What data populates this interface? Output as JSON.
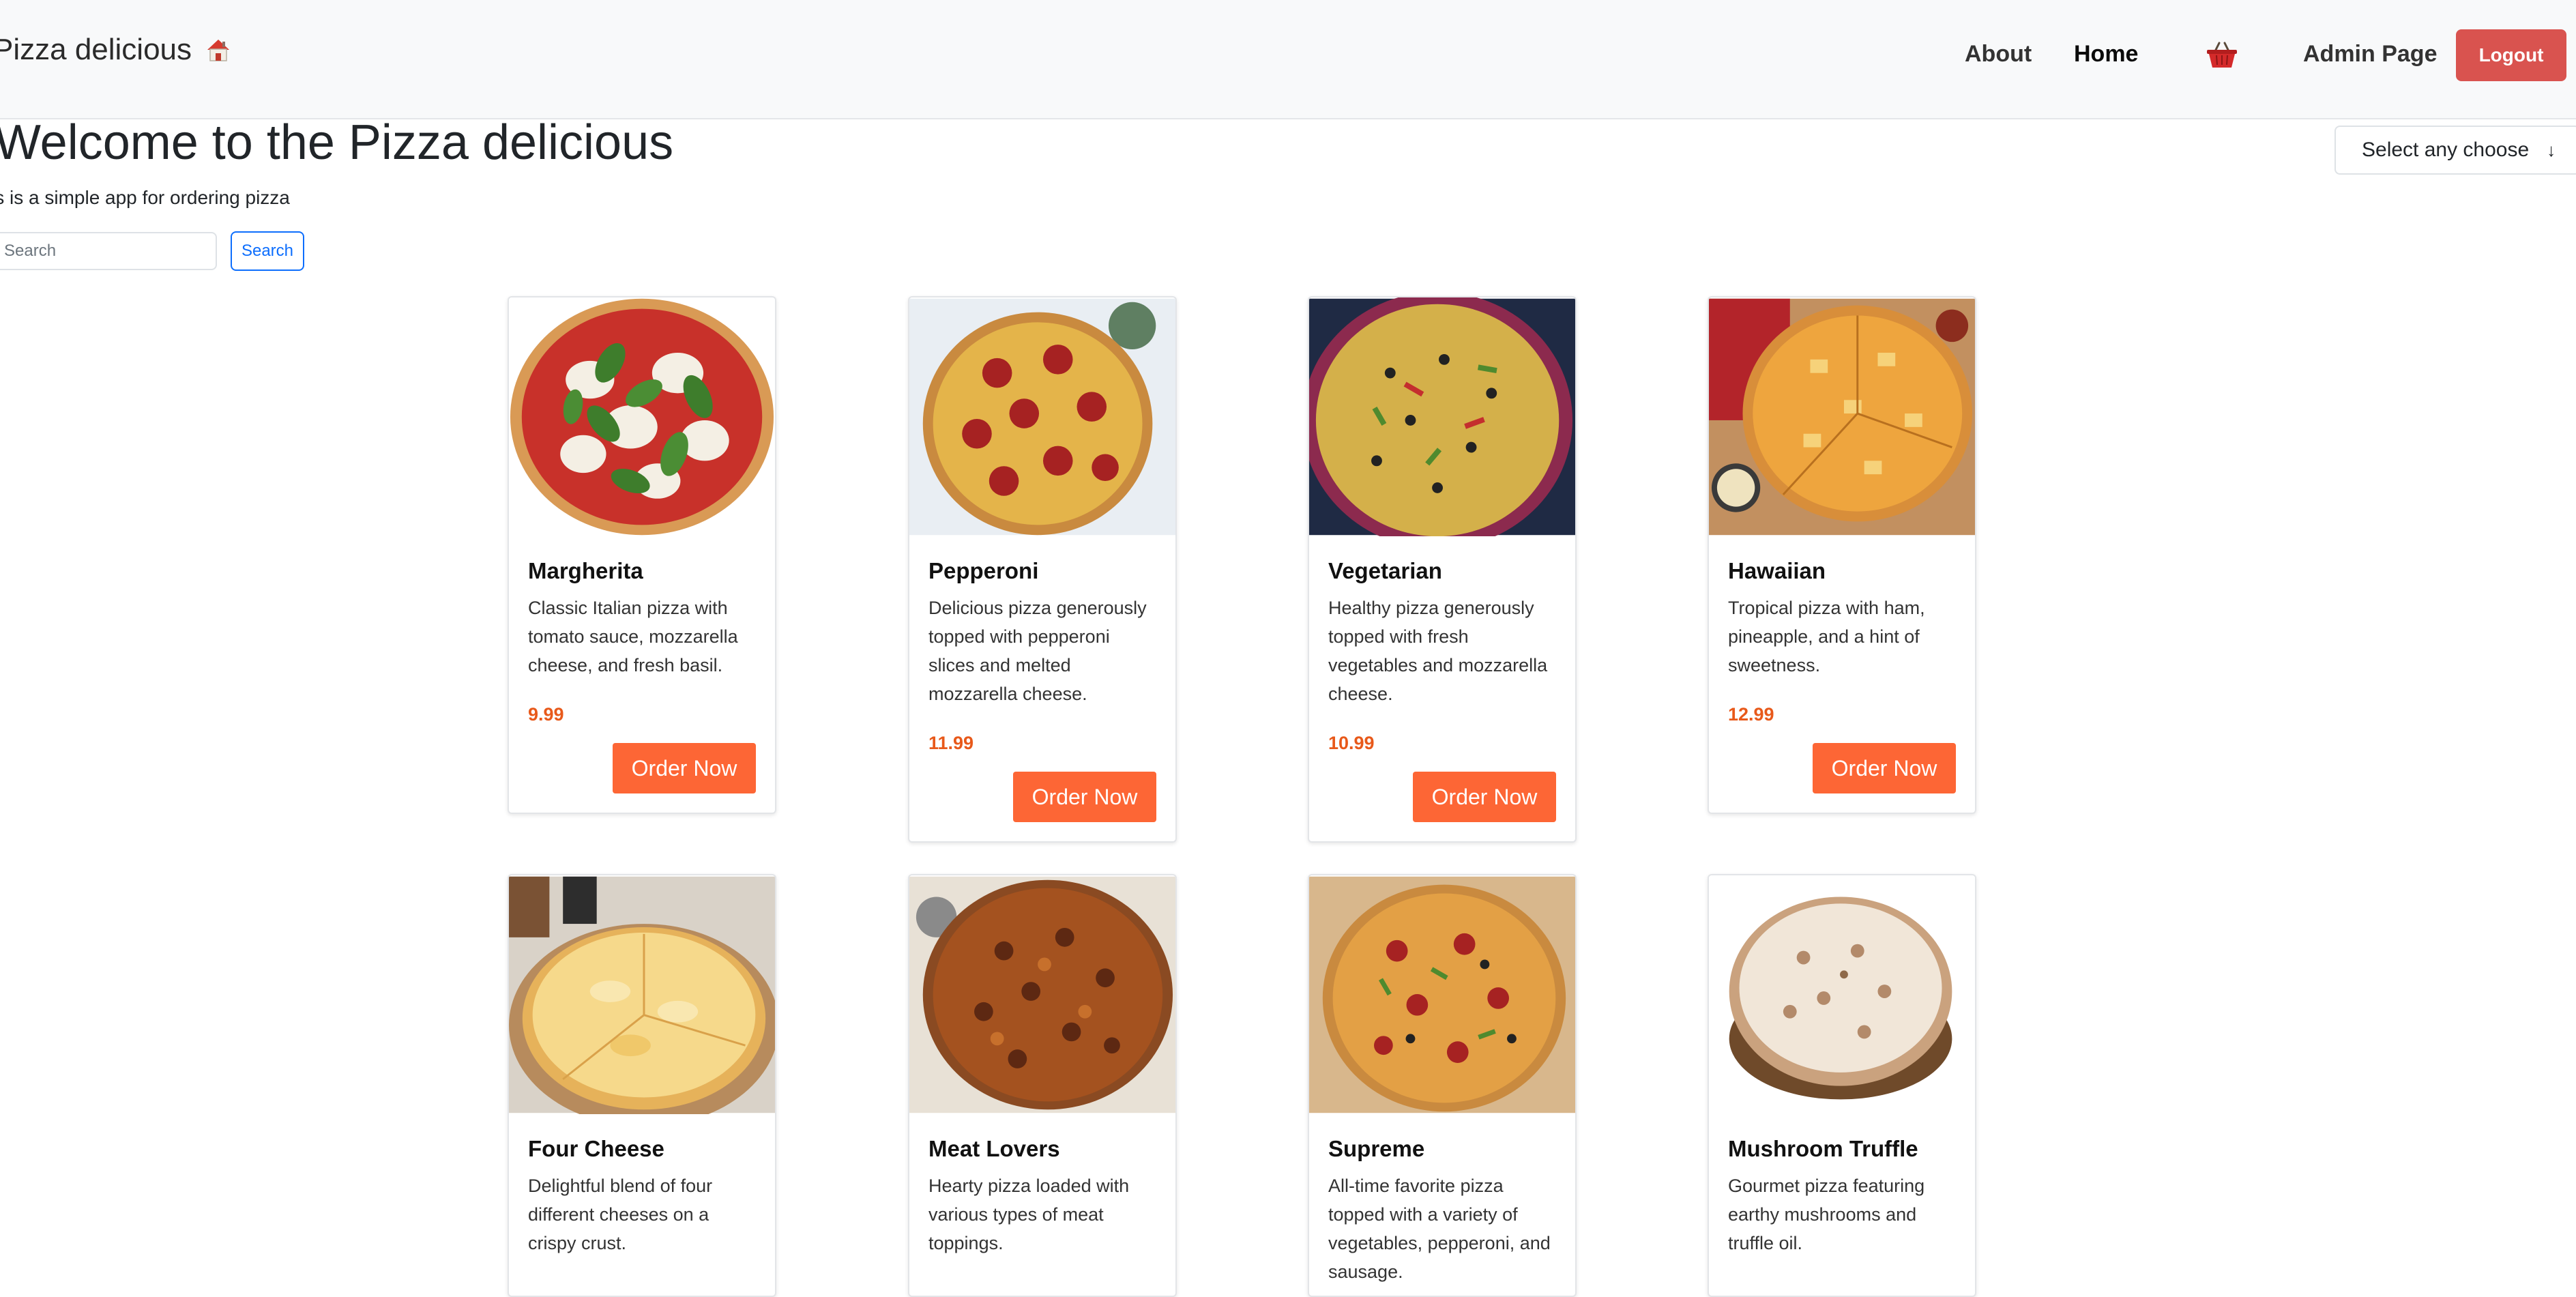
{
  "navbar": {
    "brand": "Pizza delicious",
    "brand_icon": "house-icon",
    "links": [
      {
        "label": "About"
      },
      {
        "label": "Home"
      }
    ],
    "cart_icon": "shopping-basket-icon",
    "admin_label": "Admin Page",
    "logout_label": "Logout",
    "logout_color": "#d9534f"
  },
  "header": {
    "title": "Welcome to the Pizza delicious",
    "subtitle": "is is a simple app for ordering pizza",
    "search_placeholder": "Search",
    "search_button": "Search",
    "select_label": "Select any choose",
    "select_arrow": "↓"
  },
  "accent_color": "#fd6635",
  "products": [
    {
      "name": "Margherita",
      "description": "Classic Italian pizza with tomato sauce, mozzarella cheese, and fresh basil.",
      "price": "9.99",
      "button": "Order Now"
    },
    {
      "name": "Pepperoni",
      "description": "Delicious pizza generously topped with pepperoni slices and melted mozzarella cheese.",
      "price": "11.99",
      "button": "Order Now"
    },
    {
      "name": "Vegetarian",
      "description": "Healthy pizza generously topped with fresh vegetables and mozzarella cheese.",
      "price": "10.99",
      "button": "Order Now"
    },
    {
      "name": "Hawaiian",
      "description": "Tropical pizza with ham, pineapple, and a hint of sweetness.",
      "price": "12.99",
      "button": "Order Now"
    },
    {
      "name": "Four Cheese",
      "description": "Delightful blend of four different cheeses on a crispy crust.",
      "price": "",
      "button": ""
    },
    {
      "name": "Meat Lovers",
      "description": "Hearty pizza loaded with various types of meat toppings.",
      "price": "",
      "button": ""
    },
    {
      "name": "Supreme",
      "description": "All-time favorite pizza topped with a variety of vegetables, pepperoni, and sausage.",
      "price": "",
      "button": ""
    },
    {
      "name": "Mushroom Truffle",
      "description": "Gourmet pizza featuring earthy mushrooms and truffle oil.",
      "price": "",
      "button": ""
    }
  ]
}
